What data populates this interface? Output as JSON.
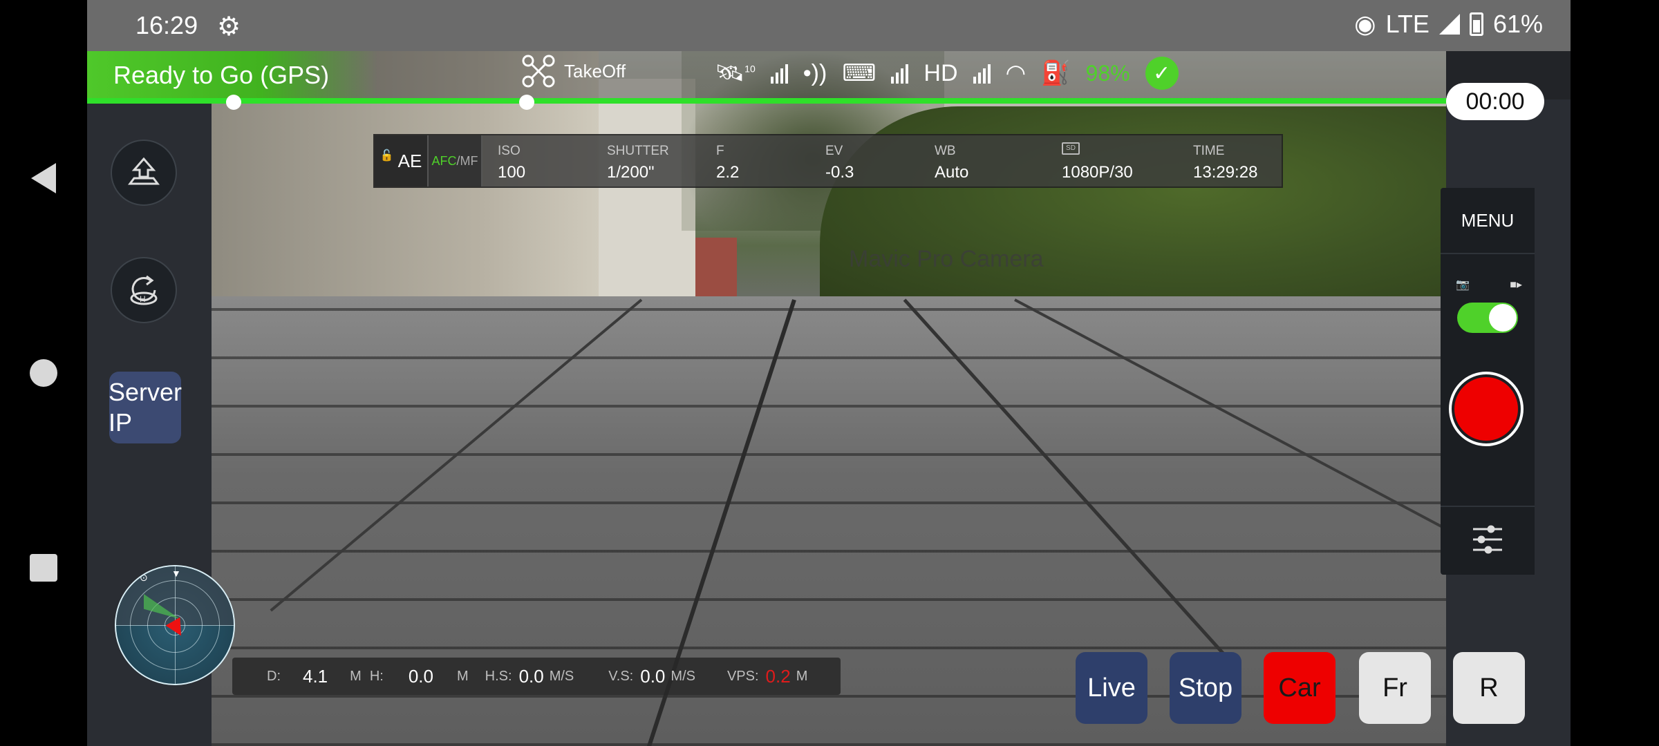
{
  "status_bar": {
    "time": "16:29",
    "network": "LTE",
    "battery": "61%"
  },
  "flight_status": {
    "text": "Ready to Go (GPS)",
    "color": "#4fc82a"
  },
  "top_bar": {
    "takeoff_label": "TakeOff",
    "satellites": "10",
    "hd_label": "HD",
    "battery_pct": "98%"
  },
  "timer": "00:00",
  "camera_watermark": "Mavic Pro Camera",
  "camera_settings": {
    "ae": "AE",
    "afc": "AFC",
    "mf": "/MF",
    "fields": [
      {
        "label": "ISO",
        "value": "100"
      },
      {
        "label": "SHUTTER",
        "value": "1/200\""
      },
      {
        "label": "F",
        "value": "2.2"
      },
      {
        "label": "EV",
        "value": "-0.3"
      },
      {
        "label": "WB",
        "value": "Auto"
      },
      {
        "label": "",
        "value": "1080P/30"
      },
      {
        "label": "TIME",
        "value": "13:29:28"
      }
    ]
  },
  "left_controls": {
    "server_ip_label": "Server IP"
  },
  "telemetry": {
    "d_label": "D:",
    "d_value": "4.1",
    "d_unit": "M",
    "h_label": "H:",
    "h_value": "0.0",
    "h_unit": "M",
    "hs_label": "H.S:",
    "hs_value": "0.0",
    "hs_unit": "M/S",
    "vs_label": "V.S:",
    "vs_value": "0.0",
    "vs_unit": "M/S",
    "vps_label": "VPS:",
    "vps_value": "0.2",
    "vps_unit": "M"
  },
  "right_panel": {
    "menu_label": "MENU",
    "video_mode_on": true
  },
  "actions": {
    "live": "Live",
    "stop": "Stop",
    "car": "Car",
    "fr": "Fr",
    "r": "R"
  },
  "icons": [
    "gear-icon",
    "hotspot-icon",
    "signal-icon",
    "battery-icon",
    "drone-takeoff-icon",
    "satellite-icon",
    "remote-signal-icon",
    "controller-icon",
    "hd-signal-icon",
    "wifi-icon",
    "aircraft-battery-icon",
    "check-icon",
    "lock-icon",
    "upload-takeoff-icon",
    "return-home-icon",
    "camera-icon",
    "video-icon",
    "sliders-icon"
  ]
}
